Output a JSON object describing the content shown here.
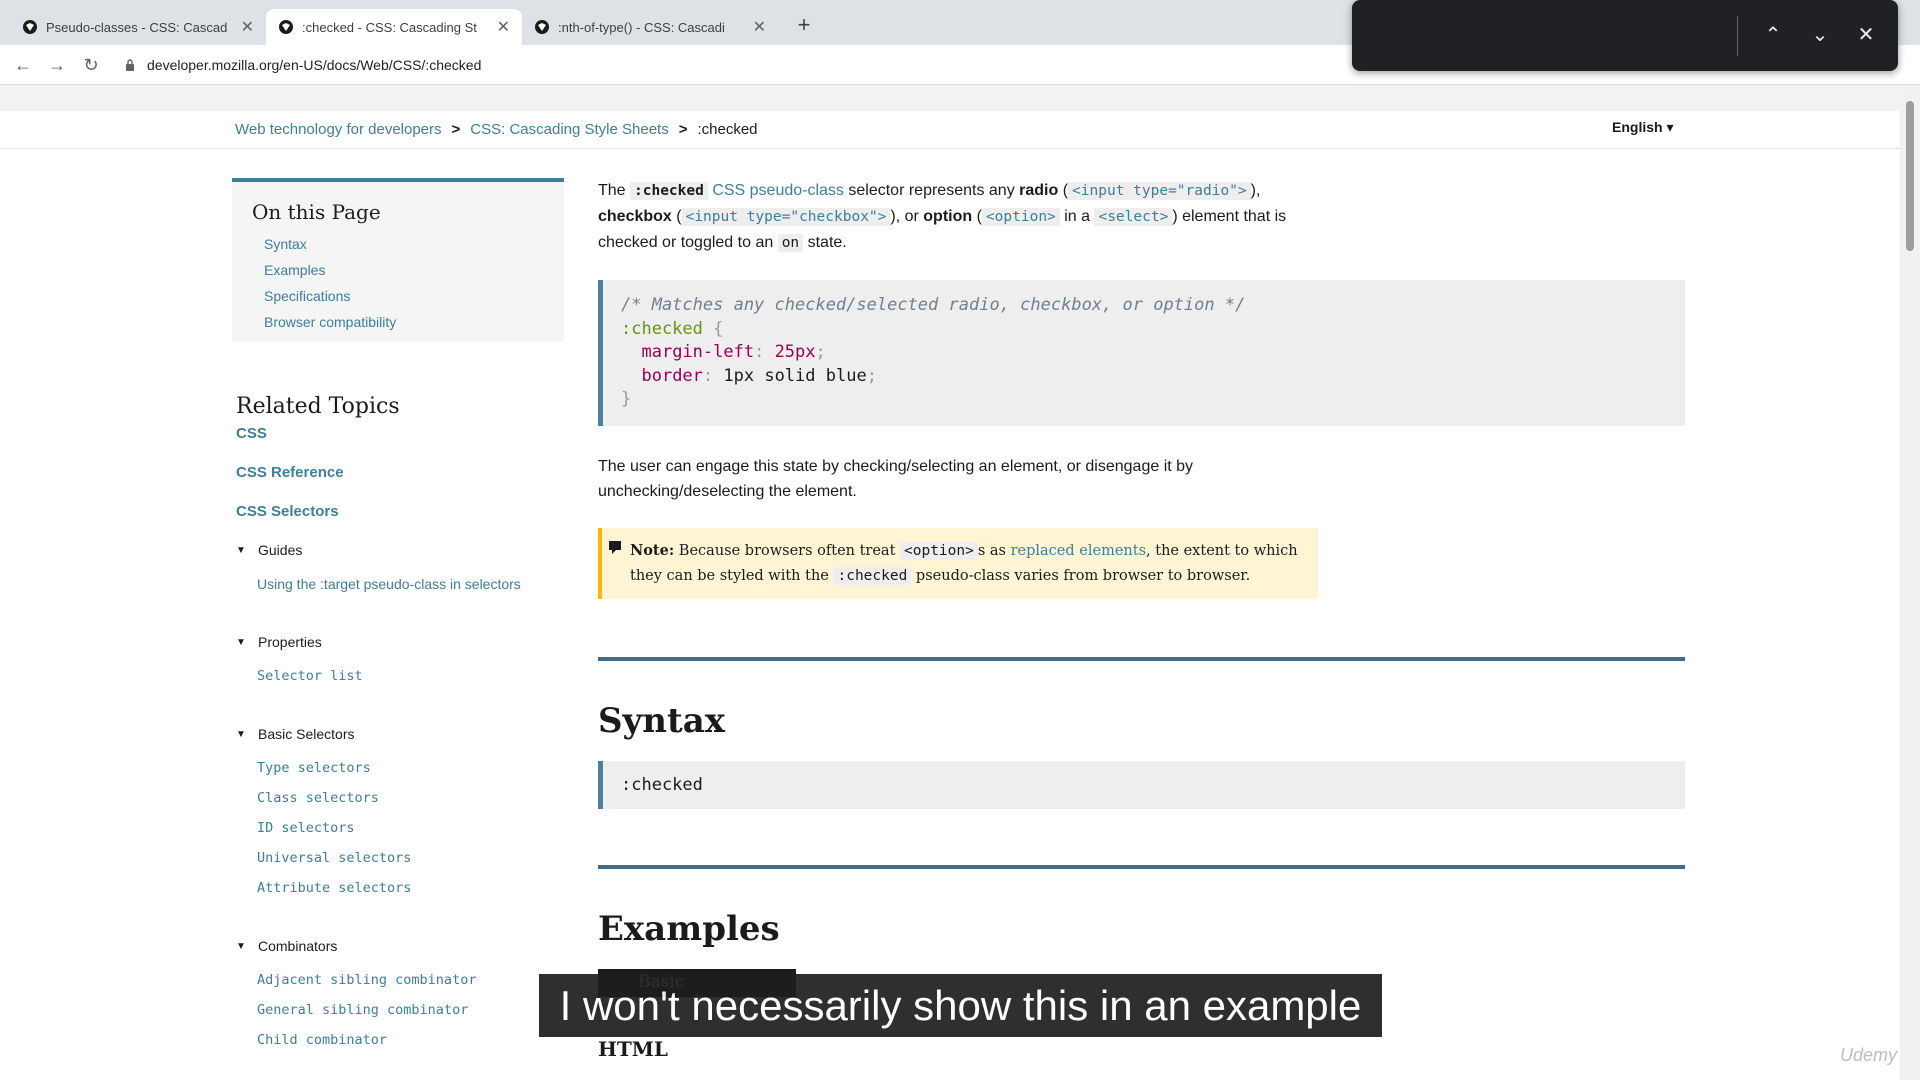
{
  "browser": {
    "tabs": [
      {
        "title": "Pseudo-classes - CSS: Cascad",
        "active": false
      },
      {
        "title": ":checked - CSS: Cascading St",
        "active": true
      },
      {
        "title": ":nth-of-type() - CSS: Cascadi",
        "active": false
      }
    ],
    "new_tab": "+",
    "url": "developer.mozilla.org/en-US/docs/Web/CSS/:checked"
  },
  "find_bar": {
    "prev": "⌃",
    "next": "⌄",
    "close": "✕"
  },
  "breadcrumb": {
    "items": [
      "Web technology for developers",
      "CSS: Cascading Style Sheets",
      ":checked"
    ],
    "separator": ">"
  },
  "language": "English ▾",
  "toc": {
    "title": "On this Page",
    "items": [
      "Syntax",
      "Examples",
      "Specifications",
      "Browser compatibility"
    ]
  },
  "related": {
    "title": "Related Topics",
    "links": [
      "CSS",
      "CSS Reference",
      "CSS Selectors"
    ],
    "groups": [
      {
        "name": "Guides",
        "items": [
          "Using the :target pseudo-class in selectors"
        ]
      },
      {
        "name": "Properties",
        "items": [
          "Selector list"
        ]
      },
      {
        "name": "Basic Selectors",
        "items": [
          "Type selectors",
          "Class selectors",
          "ID selectors",
          "Universal selectors",
          "Attribute selectors"
        ]
      },
      {
        "name": "Combinators",
        "items": [
          "Adjacent sibling combinator",
          "General sibling combinator",
          "Child combinator"
        ]
      }
    ]
  },
  "intro": {
    "t1": "The ",
    "code1": ":checked",
    "link1": "CSS pseudo-class",
    "t2": " selector represents any ",
    "b1": "radio",
    "t3": " (",
    "code2": "<input type=\"radio\">",
    "t4": "), ",
    "b2": "checkbox",
    "t5": " (",
    "code3": "<input type=\"checkbox\">",
    "t6": "), or ",
    "b3": "option",
    "t7": " (",
    "code4": "<option>",
    "t8": " in a ",
    "code5": "<select>",
    "t9": ") element that is checked or toggled to an ",
    "code6": "on",
    "t10": " state."
  },
  "code_example": {
    "comment": "/* Matches any checked/selected radio, checkbox, or option */",
    "selector": ":checked",
    "open": " {",
    "p1": "margin-left",
    "v1": "25px",
    "p2": "border",
    "v2": "1px solid blue",
    "close": "}"
  },
  "para2": "The user can engage this state by checking/selecting an element, or disengage it by unchecking/deselecting the element.",
  "note": {
    "label": "Note:",
    "t1": " Because browsers often treat ",
    "code1": "<option>",
    "t2": "s as ",
    "link": "replaced elements",
    "t3": ", the extent to which they can be styled with the ",
    "code2": ":checked",
    "t4": " pseudo-class varies from browser to browser."
  },
  "syntax": {
    "heading": "Syntax",
    "code": ":checked"
  },
  "examples": {
    "heading": "Examples",
    "button": "Basic example",
    "subheading": "HTML"
  },
  "subtitle": "I won't necessarily show this in an example",
  "watermark": "Udemy"
}
